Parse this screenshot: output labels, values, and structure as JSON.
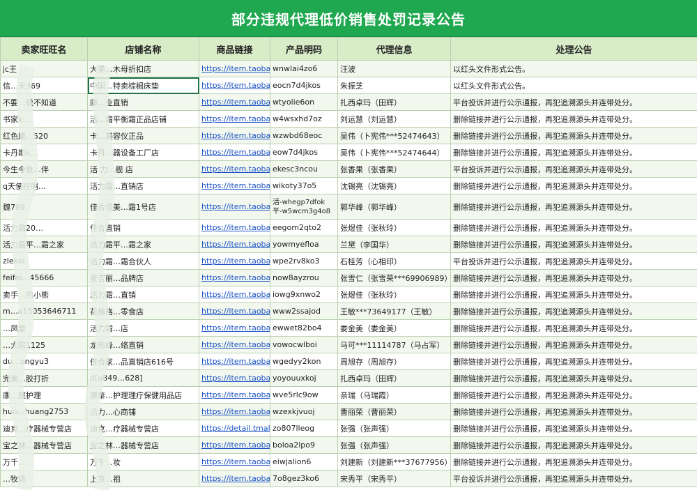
{
  "title": "部分违规代理低价销售处罚记录公告",
  "columns": [
    "卖家旺旺名",
    "店铺名称",
    "商品链接",
    "产品明码",
    "代理信息",
    "处理公告"
  ],
  "rows": [
    [
      "jc王",
      "大美…木母折扣店",
      "https://item.taobao.c",
      "wnwlai4zo6",
      "汪波",
      "以红头文件形式公告。"
    ],
    [
      "信…天369",
      "中国…特卖棕榈床垫",
      "https://item.taobao.c",
      "eocn7d4jkos",
      "朱振芝",
      "以红头文件形式公告。"
    ],
    [
      "不要…说不知道",
      "康…业直销",
      "https://item.taobao.c",
      "wtyolie6on",
      "扎西卓玛（田辉）",
      "平台投诉并进行公示通报，再犯追溯源头并连带处分。"
    ],
    [
      "书家k…",
      "活…霜平衡霜正品店铺",
      "https://item.taobao.c",
      "w4wsxhd7oz",
      "刘运慧（刘运慧）",
      "删除链接并进行公示通报，再犯追溯源头并连带处分。"
    ],
    [
      "红色康…520",
      "卡…美容仪正品",
      "https://item.taobao.c",
      "wzwbd68eoc",
      "吴伟（卜宪伟***52474643）",
      "删除链接并进行公示通报，再犯追溯源头并连带处分。"
    ],
    [
      "卡丹斯k…",
      "卡丹…器设备工厂店",
      "https://item.taobao.c",
      "eow7d4jkos",
      "吴伟（卜宪伟***52474644）",
      "删除链接并进行公示通报，再犯追溯源头并连带处分。"
    ],
    [
      "今生今世…伴",
      "活 力…舰 店",
      "https://item.taobao.c",
      "ekesc3ncou",
      "张香果（张香果）",
      "平台投诉并进行公示通报，再犯追溯源头并连带处分。"
    ],
    [
      "q天使在唱…",
      "活力霜…直销店",
      "https://item.taobao.c",
      "wikoty37o5",
      "沈锡亮（沈锡亮）",
      "删除链接并进行公示通报，再犯追溯源头并连带处分。"
    ],
    [
      "魏789",
      "佳合佳美…霜1号店",
      "https://item.taobao.c",
      "活-whegp7dfok 平-w5wcm3g4o8",
      "郭华峰（郭华峰）",
      "删除链接并进行公示通报，再犯追溯源头并连带处分。"
    ],
    [
      "活力霜20…",
      "佳合直销",
      "https://item.taobao.c",
      "eegom2qto2",
      "张煜佳（张秋玲）",
      "删除链接并进行公示通报，再犯追溯源头并连带处分。"
    ],
    [
      "活力霜平…霜之家",
      "活力霜平…霜之家",
      "https://item.taobao.c",
      "yowmyefloa",
      "兰黛（李国华）",
      "删除链接并进行公示通报，再犯追溯源头并连带处分。"
    ],
    [
      "zlekai",
      "活力霜…霜合伙人",
      "https://item.taobao.c",
      "wpe2rv8ko3",
      "石桂芳（心相印）",
      "平台投诉并进行公示通报，再犯追溯源头并连带处分。"
    ],
    [
      "feifei…45666",
      "麦吉丽…品牌店",
      "https://item.taobao.c",
      "now8ayzrou",
      "张雪仁（张雪荣***69906989）",
      "删除链接并进行公示通报，再犯追溯源头并连带处分。"
    ],
    [
      "卖手…的小熊",
      "活力霜…直销",
      "https://item.taobao.c",
      "iowg9xnwo2",
      "张煜佳（张秋玲）",
      "删除链接并进行公示通报，再犯追溯源头并连带处分。"
    ],
    [
      "m…a15053646711",
      "花格格…零食店",
      "https://item.taobao.c",
      "www2ssajod",
      "王敏***73649177（王敏）",
      "删除链接并进行公示通报，再犯追溯源头并连带处分。"
    ],
    [
      "…凤雷",
      "活力霜…店",
      "https://item.taobao.c",
      "ewwet82bo4",
      "娄金美（娄金美）",
      "删除链接并进行公示通报，再犯追溯源头并连带处分。"
    ],
    [
      "…大院1125",
      "龙布峰…络直销",
      "https://item.taobao.c",
      "vowocwlboi",
      "马可***11114787（马占军）",
      "删除链接并进行公示通报，再犯追溯源头并连带处分。"
    ],
    [
      "du…ongyu3",
      "佳合家…品直销店616号",
      "https://item.taobao.c",
      "wgedyy2kon",
      "周旭存（周旭存）",
      "删除链接并进行公示通报，再犯追溯源头并连带处分。"
    ],
    [
      "完美…胶打折",
      "d[u849…628]",
      "https://item.taobao.c",
      "yoyouuxkoj",
      "扎西卓玛（田辉）",
      "删除链接并进行公示通报，再犯追溯源头并连带处分。"
    ],
    [
      "康…庭护理",
      "康泰…护理理疗保健用品店",
      "https://item.taobao.c",
      "wve5rlc9ow",
      "亲瑞（马瑞霞）",
      "删除链接并进行公示通报，再犯追溯源头并连带处分。"
    ],
    [
      "huo…huang2753",
      "活力…心商铺",
      "https://item.taobao.c",
      "wzexkjvuoj",
      "曹丽荣（曹丽荣）",
      "删除链接并进行公示通报，再犯追溯源头并连带处分。"
    ],
    [
      "迪克…疗器械专营店",
      "迪克…疗器械专营店",
      "https://detail.tmall.co",
      "zo807lleog",
      "张强（张声强）",
      "删除链接并进行公示通报，再犯追溯源头并连带处分。"
    ],
    [
      "宝之林…器械专营店",
      "宝之林…器械专营店",
      "https://item.taobao.c",
      "boloa2lpo9",
      "张强（张声强）",
      "删除链接并进行公示通报，再犯追溯源头并连带处分。"
    ],
    [
      "万千…",
      "万千…妆",
      "https://item.taobao.c",
      "eiwjalion6",
      "刘建新（刘建新***37677956）",
      "删除链接并进行公示通报，再犯追溯源头并连带处分。"
    ],
    [
      "…牧场",
      "上京…祖",
      "https://item.taobao.c",
      "7o8gez3ko6",
      "宋秀平（宋秀平）",
      "平台投诉并进行公示通报，再犯追溯源头并连带处分。"
    ]
  ]
}
